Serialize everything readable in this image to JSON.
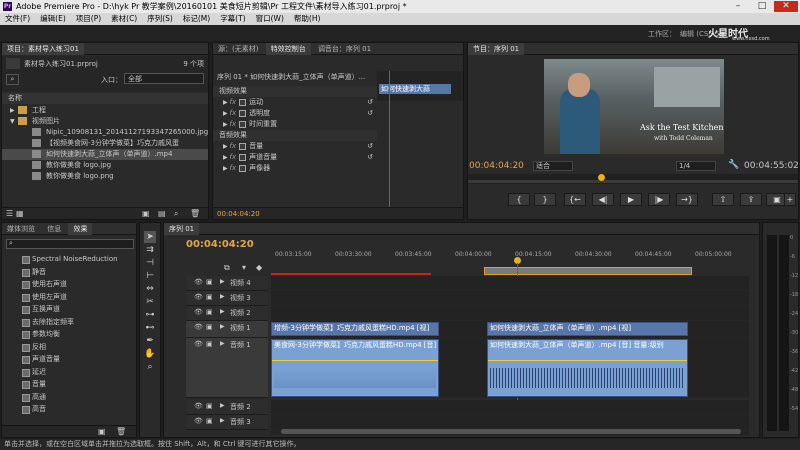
{
  "window": {
    "title": "Adobe Premiere Pro - D:\\hyk Pr 教学案例\\20160101 美食短片剪辑\\Pr 工程文件\\素材导入练习01.prproj *",
    "app_icon": "Pr"
  },
  "menu": [
    "文件(F)",
    "编辑(E)",
    "项目(P)",
    "素材(C)",
    "序列(S)",
    "标记(M)",
    "字幕(T)",
    "窗口(W)",
    "帮助(H)"
  ],
  "workspace": {
    "label": "工作区：",
    "value": "编辑 (CS5.5)"
  },
  "watermark": {
    "name": "火星时代",
    "url": "www.hxsd.com"
  },
  "project": {
    "tabs": [
      "项目：素材导入练习01",
      "源：(无素材)"
    ],
    "file": "素材导入练习01.prproj",
    "count": "9 个项",
    "in_label": "入口：",
    "in_value": "全部",
    "name_col": "名称",
    "items": [
      {
        "name": "工程",
        "type": "folder",
        "indent": 0
      },
      {
        "name": "视频图片",
        "type": "folder-open",
        "indent": 0
      },
      {
        "name": "Nipic_10908131_20141127193347265000.jpg",
        "type": "image",
        "indent": 1
      },
      {
        "name": "【视频美食网-3分钟学做菜】巧克力戚风蛋",
        "type": "video",
        "indent": 1
      },
      {
        "name": "如何快速剥大蒜_立体声（单声道）.mp4",
        "type": "video",
        "indent": 1
      },
      {
        "name": "教你做美食 logo.jpg",
        "type": "image",
        "indent": 1
      },
      {
        "name": "教你做美食 logo.png",
        "type": "image",
        "indent": 1
      }
    ]
  },
  "effect_controls": {
    "tabs": [
      "源：(无素材)",
      "特效控制台",
      "调音台：序列 01"
    ],
    "header": "序列 01 * 如何快速剥大蒜_立体声（单声道）...",
    "clip_label": "如何快速剥大蒜",
    "video_fx": "视频效果",
    "video_items": [
      "运动",
      "透明度",
      "时间重置"
    ],
    "audio_fx": "音频效果",
    "audio_items": [
      "音量",
      "声道音量",
      "声像器"
    ],
    "timecode": "00:04:04:20"
  },
  "program": {
    "tab": "节目：序列 01",
    "video_text": [
      "Ask the Test Kitchen",
      "with Todd Coleman"
    ],
    "timecode_left": "00:04:04:20",
    "fit": "适合",
    "ratio": "1/4",
    "timecode_right": "00:04:55:02"
  },
  "effects_panel": {
    "tabs": [
      "媒体浏览",
      "信息",
      "效果"
    ],
    "items": [
      "Spectral NoiseReduction",
      "静音",
      "使用右声道",
      "使用左声道",
      "互换声道",
      "去除指定频率",
      "参数均衡",
      "反相",
      "声道音量",
      "延迟",
      "音量",
      "高通",
      "高音"
    ]
  },
  "timeline": {
    "tab": "序列 01",
    "timecode": "00:04:04:20",
    "ruler": [
      "00:03:15:00",
      "00:03:30:00",
      "00:03:45:00",
      "00:04:00:00",
      "00:04:15:00",
      "00:04:30:00",
      "00:04:45:00",
      "00:05:00:00"
    ],
    "video_tracks": [
      "视频 4",
      "视频 3",
      "视频 2",
      "视频 1"
    ],
    "audio_tracks": [
      "音频 1",
      "音频 2",
      "音频 3"
    ],
    "clip_v1_a": "增频-3分钟学做菜】巧克力戚风蛋糕HD.mp4 [视]",
    "clip_v1_b": "如何快速剥大蒜_立体声（单声道）.mp4 [视]",
    "clip_a1_a": "美食网-3分钟学做菜】巧克力戚风蛋糕HD.mp4 [音] 音量:级别",
    "clip_a1_b": "如何快速剥大蒜_立体声（单声道）.mp4 [音] 音量:级别"
  },
  "status": "单击并选择，或在空白区域单击并拖拉为选取框。按住 Shift，Alt，和 Ctrl 键可进行其它操作。",
  "audio_meter_labels": [
    "0",
    "-6",
    "-12",
    "-18",
    "-24",
    "-30",
    "-36",
    "-42",
    "-48",
    "-54"
  ]
}
